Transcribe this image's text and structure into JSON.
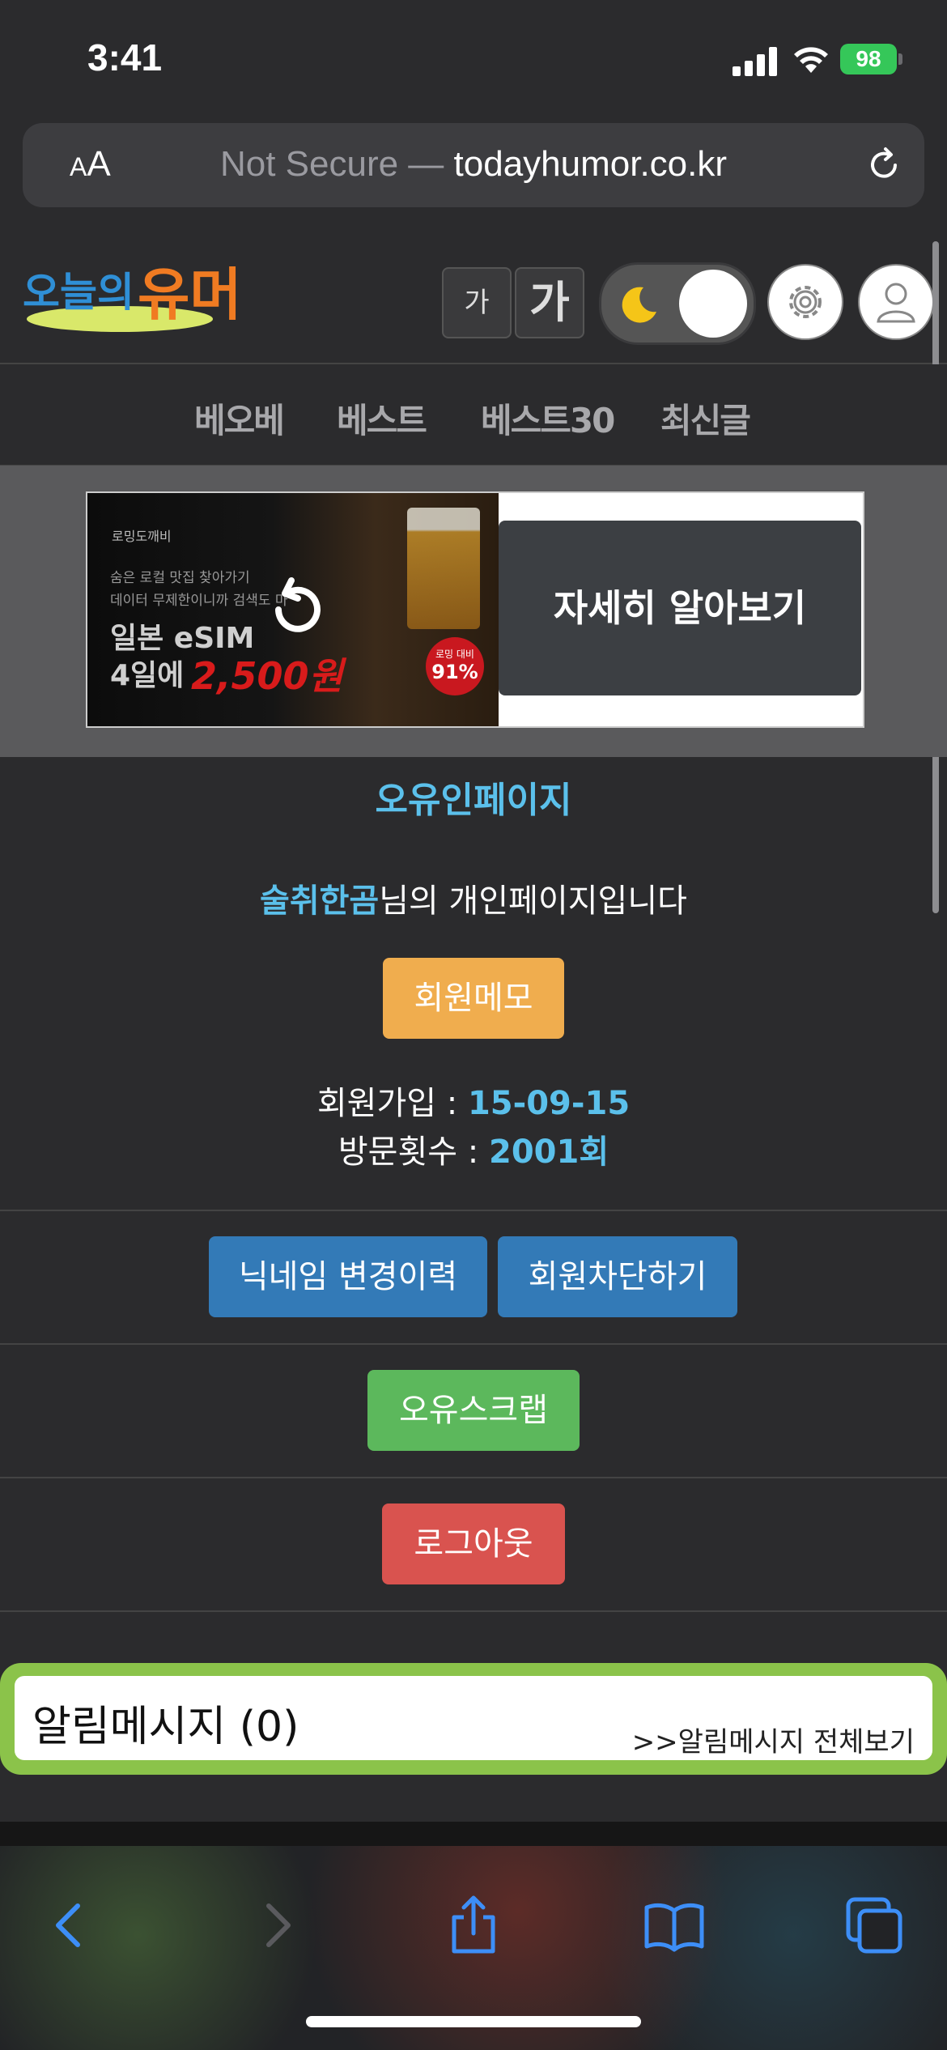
{
  "status": {
    "time": "3:41",
    "battery": "98"
  },
  "browser": {
    "aa_small": "A",
    "aa_large": "A",
    "not_secure": "Not Secure —",
    "domain": "todayhumor.co.kr"
  },
  "header": {
    "font_small": "가",
    "font_large": "가"
  },
  "nav": {
    "items": [
      "베오베",
      "베스트",
      "베스트30",
      "최신글"
    ]
  },
  "ad": {
    "brand": "로밍도깨비",
    "line1": "숨은 로컬 맛집 찾아가기",
    "line2": "데이터 무제한이니까 검색도 마",
    "esim": "일본 eSIM",
    "days": "4일에",
    "price": "2,500원",
    "badge_top": "로밍 대비",
    "badge_value": "91%",
    "cta": "자세히 알아보기"
  },
  "profile": {
    "title": "오유인페이지",
    "nickname": "술취한곰",
    "greeting_suffix": "님의 개인페이지입니다",
    "memo_button": "회원메모",
    "join_label": "회원가입 : ",
    "join_value": "15-09-15",
    "visits_label": "방문횟수 : ",
    "visits_value": "2001회"
  },
  "actions": {
    "nick_history": "닉네임 변경이력",
    "block_member": "회원차단하기",
    "scrap": "오유스크랩",
    "logout": "로그아웃"
  },
  "notifications": {
    "title": "알림메시지 (0)",
    "view_all": ">>알림메시지 전체보기"
  },
  "colors": {
    "accent_blue": "#5bc0eb",
    "memo_orange": "#f0ad4e",
    "primary_blue": "#337ab7",
    "success_green": "#5cb85c",
    "danger_red": "#d9534f",
    "notif_border": "#8bc34a"
  },
  "icons": [
    "signal-icon",
    "wifi-icon",
    "reload-icon",
    "logo-icon",
    "moon-icon",
    "gear-icon",
    "user-icon",
    "replay-icon",
    "back-icon",
    "forward-icon",
    "share-icon",
    "bookmarks-icon",
    "tabs-icon"
  ]
}
